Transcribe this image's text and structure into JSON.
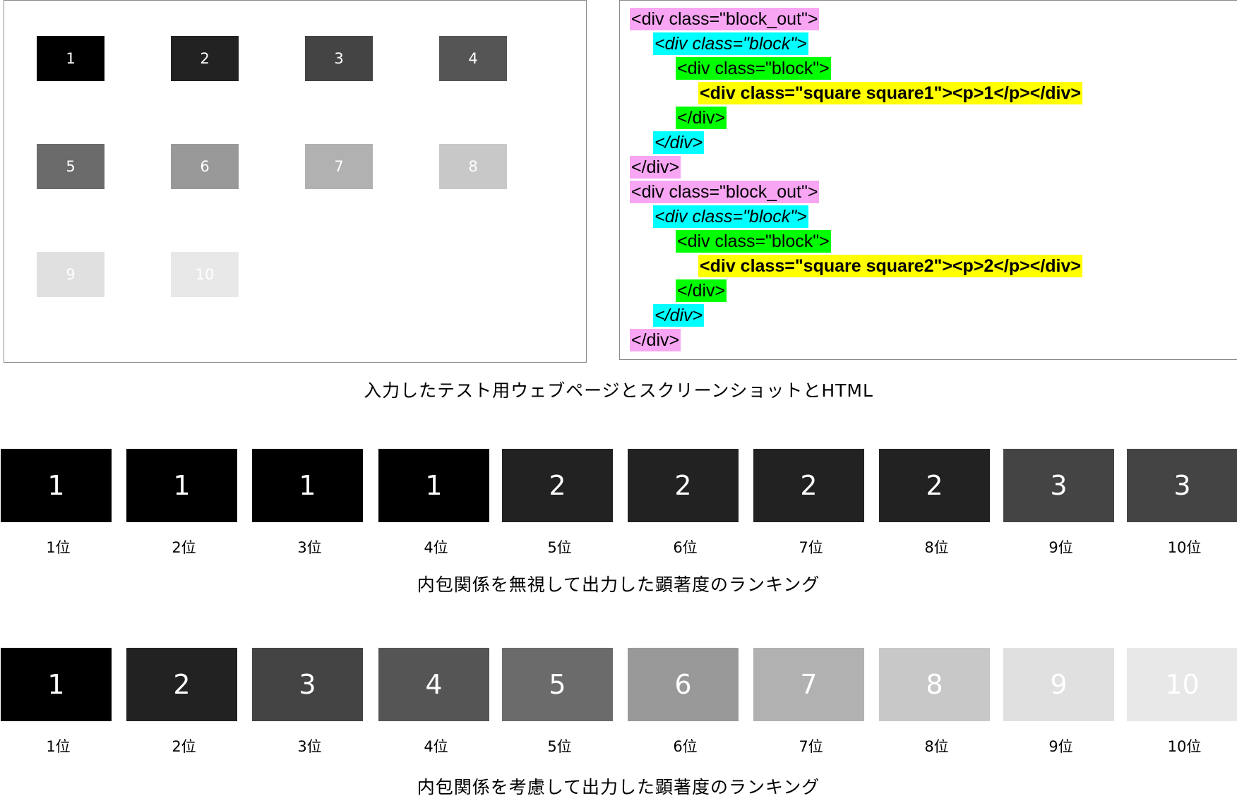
{
  "test_page": {
    "squares": [
      {
        "label": "1",
        "bg": "#000000",
        "fg": "#ffffff"
      },
      {
        "label": "2",
        "bg": "#222222",
        "fg": "#ffffff"
      },
      {
        "label": "3",
        "bg": "#444444",
        "fg": "#ffffff"
      },
      {
        "label": "4",
        "bg": "#555555",
        "fg": "#ffffff"
      },
      {
        "label": "5",
        "bg": "#6b6b6b",
        "fg": "#ffffff"
      },
      {
        "label": "6",
        "bg": "#999999",
        "fg": "#ffffff"
      },
      {
        "label": "7",
        "bg": "#b1b1b1",
        "fg": "#ffffff"
      },
      {
        "label": "8",
        "bg": "#c8c8c8",
        "fg": "#ffffff"
      },
      {
        "label": "9",
        "bg": "#e0e0e0",
        "fg": "#ffffff"
      },
      {
        "label": "10",
        "bg": "#e8e8e8",
        "fg": "#ffffff"
      }
    ]
  },
  "code": {
    "highlight_colors": {
      "block_out": "#f8a5f3",
      "block_outer": "#00ffff",
      "block_inner": "#00ff00",
      "square": "#ffff00"
    },
    "lines": [
      {
        "text": "<div class=\"block_out\">",
        "level": 0,
        "hl": "block_out",
        "style": ""
      },
      {
        "text": "<div class=\"block\">",
        "level": 1,
        "hl": "block_outer",
        "style": "ital"
      },
      {
        "text": "<div class=\"block\">",
        "level": 2,
        "hl": "block_inner",
        "style": ""
      },
      {
        "text": "<div class=\"square square1\"><p>1</p></div>",
        "level": 3,
        "hl": "square",
        "style": "bold"
      },
      {
        "text": "</div>",
        "level": 2,
        "hl": "block_inner",
        "style": ""
      },
      {
        "text": "</div>",
        "level": 1,
        "hl": "block_outer",
        "style": "ital"
      },
      {
        "text": "</div>",
        "level": 0,
        "hl": "block_out",
        "style": ""
      },
      {
        "text": "<div class=\"block_out\">",
        "level": 0,
        "hl": "block_out",
        "style": ""
      },
      {
        "text": "<div class=\"block\">",
        "level": 1,
        "hl": "block_outer",
        "style": "ital"
      },
      {
        "text": "<div class=\"block\">",
        "level": 2,
        "hl": "block_inner",
        "style": ""
      },
      {
        "text": "<div class=\"square square2\"><p>2</p></div>",
        "level": 3,
        "hl": "square",
        "style": "bold"
      },
      {
        "text": "</div>",
        "level": 2,
        "hl": "block_inner",
        "style": ""
      },
      {
        "text": "</div>",
        "level": 1,
        "hl": "block_outer",
        "style": "ital"
      },
      {
        "text": "</div>",
        "level": 0,
        "hl": "block_out",
        "style": ""
      }
    ]
  },
  "captions": {
    "input": "入力したテスト用ウェブページとスクリーンショットとHTML",
    "ignore": "内包関係を無視して出力した顕著度のランキング",
    "consider": "内包関係を考慮して出力した顕著度のランキング"
  },
  "rank_labels": [
    "1位",
    "2位",
    "3位",
    "4位",
    "5位",
    "6位",
    "7位",
    "8位",
    "9位",
    "10位"
  ],
  "ranking_ignore": [
    {
      "label": "1",
      "bg": "#000000",
      "fg": "#ffffff"
    },
    {
      "label": "1",
      "bg": "#000000",
      "fg": "#ffffff"
    },
    {
      "label": "1",
      "bg": "#000000",
      "fg": "#ffffff"
    },
    {
      "label": "1",
      "bg": "#000000",
      "fg": "#ffffff"
    },
    {
      "label": "2",
      "bg": "#222222",
      "fg": "#ffffff"
    },
    {
      "label": "2",
      "bg": "#222222",
      "fg": "#ffffff"
    },
    {
      "label": "2",
      "bg": "#222222",
      "fg": "#ffffff"
    },
    {
      "label": "2",
      "bg": "#222222",
      "fg": "#ffffff"
    },
    {
      "label": "3",
      "bg": "#444444",
      "fg": "#ffffff"
    },
    {
      "label": "3",
      "bg": "#444444",
      "fg": "#ffffff"
    }
  ],
  "ranking_consider": [
    {
      "label": "1",
      "bg": "#000000",
      "fg": "#ffffff"
    },
    {
      "label": "2",
      "bg": "#222222",
      "fg": "#ffffff"
    },
    {
      "label": "3",
      "bg": "#444444",
      "fg": "#ffffff"
    },
    {
      "label": "4",
      "bg": "#555555",
      "fg": "#ffffff"
    },
    {
      "label": "5",
      "bg": "#6b6b6b",
      "fg": "#ffffff"
    },
    {
      "label": "6",
      "bg": "#999999",
      "fg": "#ffffff"
    },
    {
      "label": "7",
      "bg": "#b1b1b1",
      "fg": "#ffffff"
    },
    {
      "label": "8",
      "bg": "#c8c8c8",
      "fg": "#ffffff"
    },
    {
      "label": "9",
      "bg": "#e0e0e0",
      "fg": "#ffffff"
    },
    {
      "label": "10",
      "bg": "#e8e8e8",
      "fg": "#ffffff"
    }
  ]
}
